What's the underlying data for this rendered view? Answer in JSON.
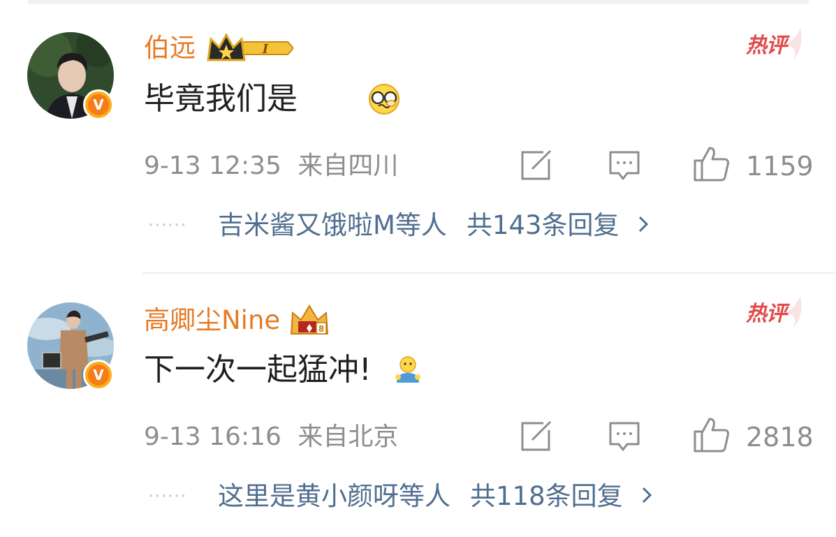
{
  "comments": [
    {
      "username": "伯远",
      "level_badge": "I",
      "hot_label": "热评",
      "content": "毕竟我们是",
      "emoji": "glasses-face-emoji",
      "time": "9-13 12:35",
      "location": "来自四川",
      "likes": "1159",
      "replies_preview": "吉米酱又饿啦M等人",
      "replies_total": "共143条回复"
    },
    {
      "username": "高卿尘Nine",
      "hot_label": "热评",
      "content": "下一次一起猛冲!",
      "emoji": "yellow-person-emoji",
      "time": "9-13 16:16",
      "location": "来自北京",
      "likes": "2818",
      "replies_preview": "这里是黄小颜呀等人",
      "replies_total": "共118条回复"
    }
  ],
  "icons": {
    "verified": "verified-v-badge",
    "share": "share-icon",
    "comment": "comment-icon",
    "like": "thumbs-up-icon",
    "more": "chevron-right-icon"
  },
  "colors": {
    "username": "#e57b26",
    "hot": "#e14a4a",
    "reply_link": "#506e8f",
    "meta": "#8d8d8d"
  }
}
